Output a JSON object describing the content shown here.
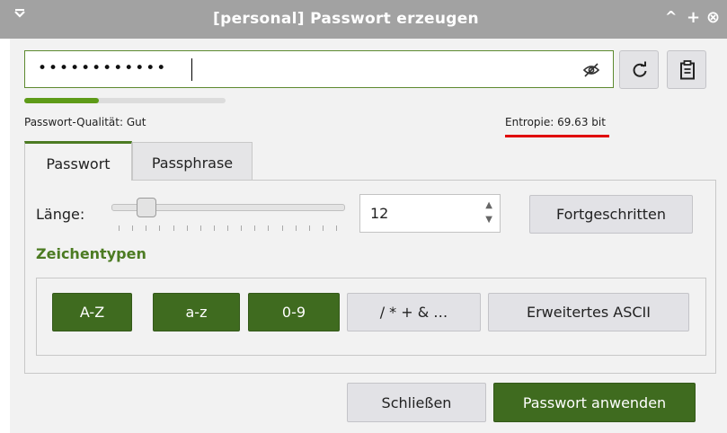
{
  "window": {
    "title": "[personal] Passwort erzeugen",
    "menu_icon": "chevron-down-icon",
    "controls": [
      "^",
      "+",
      "⊗"
    ]
  },
  "password": {
    "masked_value": "••••••••••••",
    "visibility_icon": "eye-slash-icon"
  },
  "toolbar": {
    "regenerate_icon": "refresh-icon",
    "copy_icon": "clipboard-icon"
  },
  "quality": {
    "label": "Passwort-Qualität: Gut",
    "level": 0.37,
    "bar_color": "#5e9b18"
  },
  "entropy": {
    "label": "Entropie: 69.63 bit",
    "underline_color": "#e00000"
  },
  "tabs": [
    {
      "label": "Passwort",
      "active": true
    },
    {
      "label": "Passphrase",
      "active": false
    }
  ],
  "length": {
    "label": "Länge:",
    "value": "12",
    "slider_fraction": 0.12
  },
  "advanced_button": "Fortgeschritten",
  "char_types": {
    "heading": "Zeichentypen",
    "buttons": [
      {
        "label": "A-Z",
        "selected": true
      },
      {
        "label": "a-z",
        "selected": true
      },
      {
        "label": "0-9",
        "selected": true
      },
      {
        "label": "/ * + & …",
        "selected": false
      },
      {
        "label": "Erweitertes ASCII",
        "selected": false
      }
    ]
  },
  "footer": {
    "close_label": "Schließen",
    "apply_label": "Passwort anwenden"
  },
  "colors": {
    "accent_green": "#3f6b1f",
    "titlebar": "#a2a2a2"
  }
}
